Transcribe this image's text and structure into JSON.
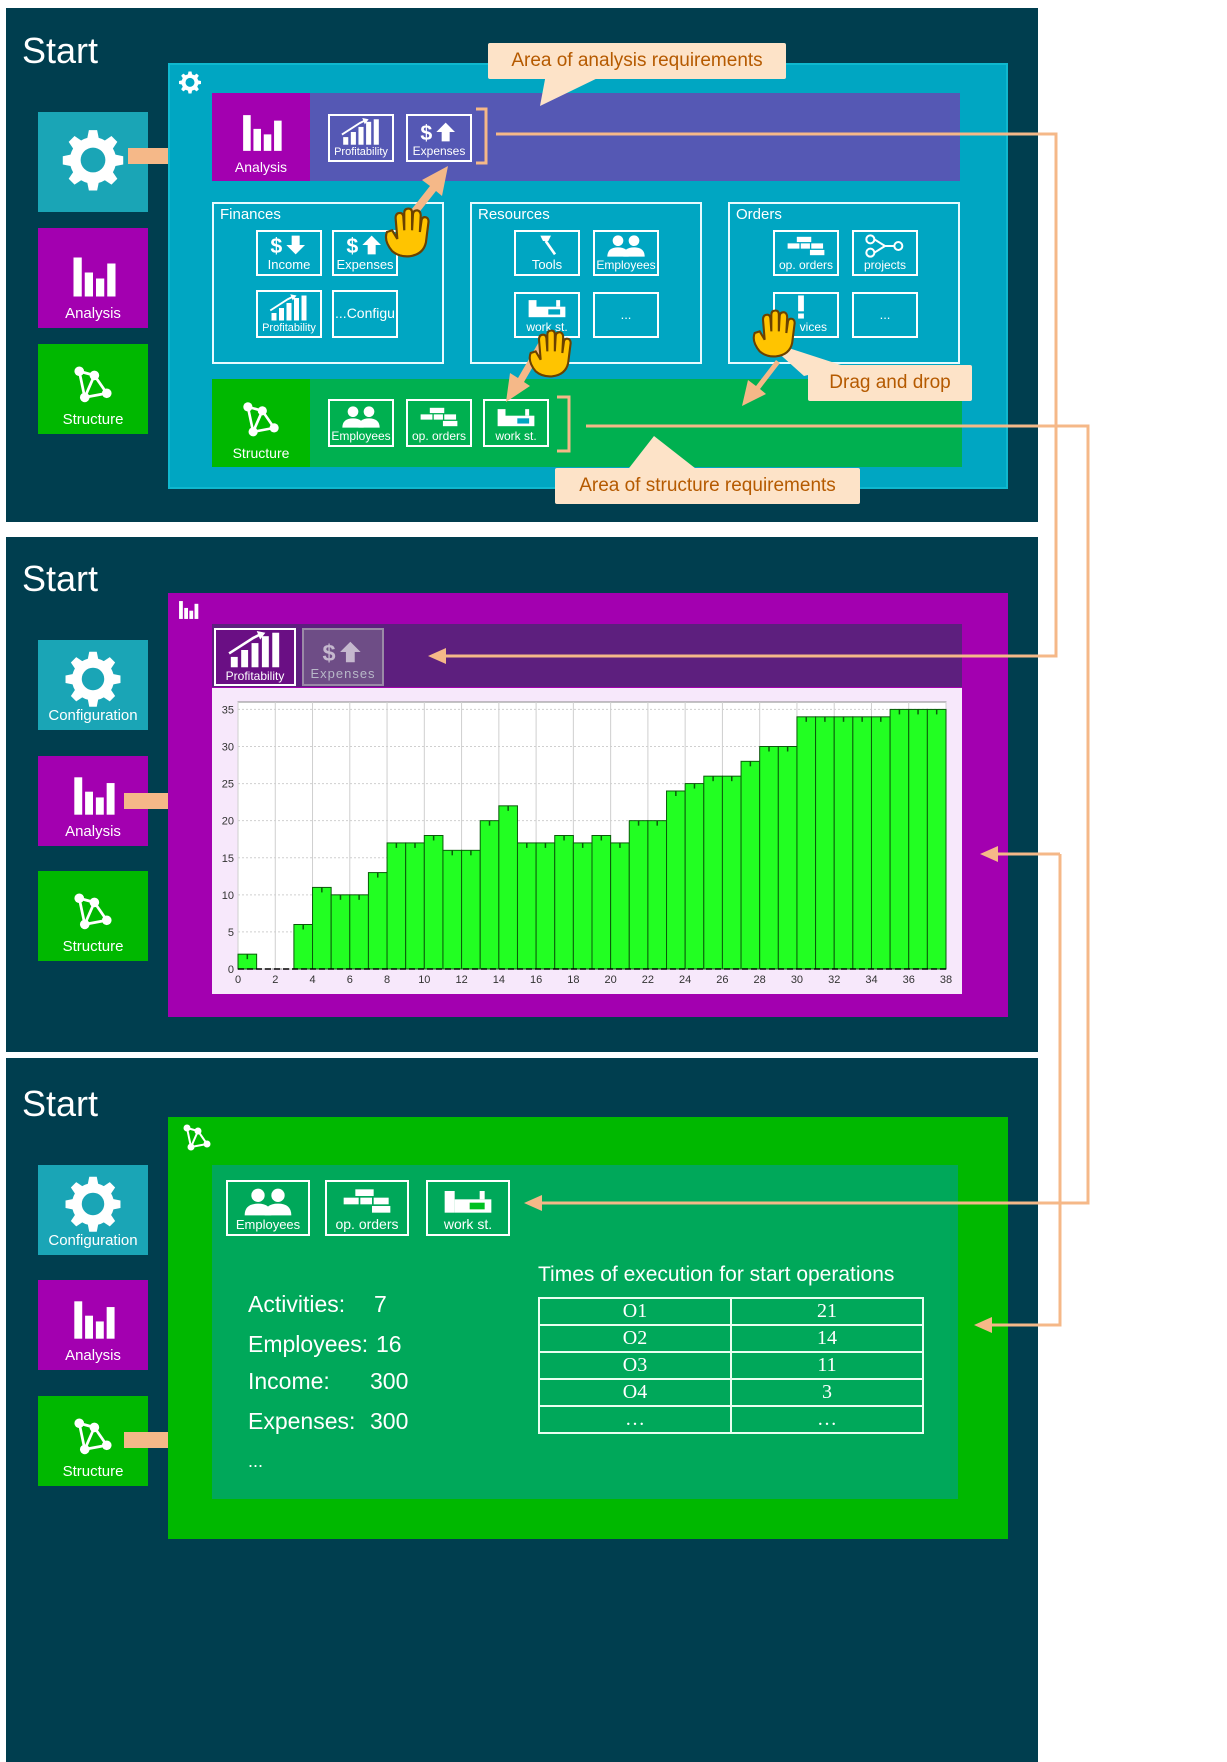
{
  "panels": [
    {
      "start_label": "Start",
      "nav": [
        "",
        "Analysis",
        "Structure"
      ],
      "analysis_area": {
        "title": "Analysis",
        "tiles": [
          "Profitability",
          "Expenses"
        ]
      },
      "groups": [
        {
          "title": "Finances",
          "tiles": [
            "Income",
            "Expenses",
            "Profitability",
            "...Configu"
          ]
        },
        {
          "title": "Resources",
          "tiles": [
            "Tools",
            "Employees",
            "work st.",
            "..."
          ]
        },
        {
          "title": "Orders",
          "tiles": [
            "op. orders",
            "projects",
            "vices",
            "..."
          ]
        }
      ],
      "structure_area": {
        "title": "Structure",
        "tiles": [
          "Employees",
          "op. orders",
          "work st."
        ]
      },
      "callouts": {
        "analysis": "Area of analysis requirements",
        "drag": "Drag and drop",
        "structure": "Area of structure requirements"
      }
    },
    {
      "start_label": "Start",
      "nav": [
        "Configuration",
        "Analysis",
        "Structure"
      ],
      "tabs": [
        "Profitability",
        "Expenses"
      ]
    },
    {
      "start_label": "Start",
      "nav": [
        "Configuration",
        "Analysis",
        "Structure"
      ],
      "tiles": [
        "Employees",
        "op. orders",
        "work st."
      ],
      "stats": [
        {
          "label": "Activities:",
          "value": "7"
        },
        {
          "label": "Employees:",
          "value": "16"
        },
        {
          "label": "Income:",
          "value": "300"
        },
        {
          "label": "Expenses:",
          "value": "300"
        }
      ],
      "stats_more": "...",
      "table_title": "Times of execution for start operations",
      "table_rows": [
        [
          "O1",
          "21"
        ],
        [
          "O2",
          "14"
        ],
        [
          "O3",
          "11"
        ],
        [
          "O4",
          "3"
        ],
        [
          "…",
          "…"
        ]
      ]
    }
  ],
  "chart_data": {
    "type": "bar",
    "x": [
      0,
      1,
      2,
      3,
      4,
      5,
      6,
      7,
      8,
      9,
      10,
      11,
      12,
      13,
      14,
      15,
      16,
      17,
      18,
      19,
      20,
      21,
      22,
      23,
      24,
      25,
      26,
      27,
      28,
      29,
      30,
      31,
      32,
      33,
      34,
      35,
      36,
      37
    ],
    "values": [
      2,
      0,
      0,
      6,
      11,
      10,
      10,
      13,
      17,
      17,
      18,
      16,
      16,
      20,
      22,
      17,
      17,
      18,
      17,
      18,
      17,
      20,
      20,
      24,
      25,
      26,
      26,
      28,
      30,
      30,
      34,
      34,
      34,
      34,
      34,
      35,
      35,
      35
    ],
    "xticks": [
      0,
      2,
      4,
      6,
      8,
      10,
      12,
      14,
      16,
      18,
      20,
      22,
      24,
      26,
      28,
      30,
      32,
      34,
      36,
      38
    ],
    "yticks": [
      0,
      5,
      10,
      15,
      20,
      25,
      30,
      35
    ],
    "xlim": [
      0,
      38
    ],
    "ylim": [
      0,
      36
    ],
    "grid": true,
    "bar_color": "#22ff22"
  }
}
